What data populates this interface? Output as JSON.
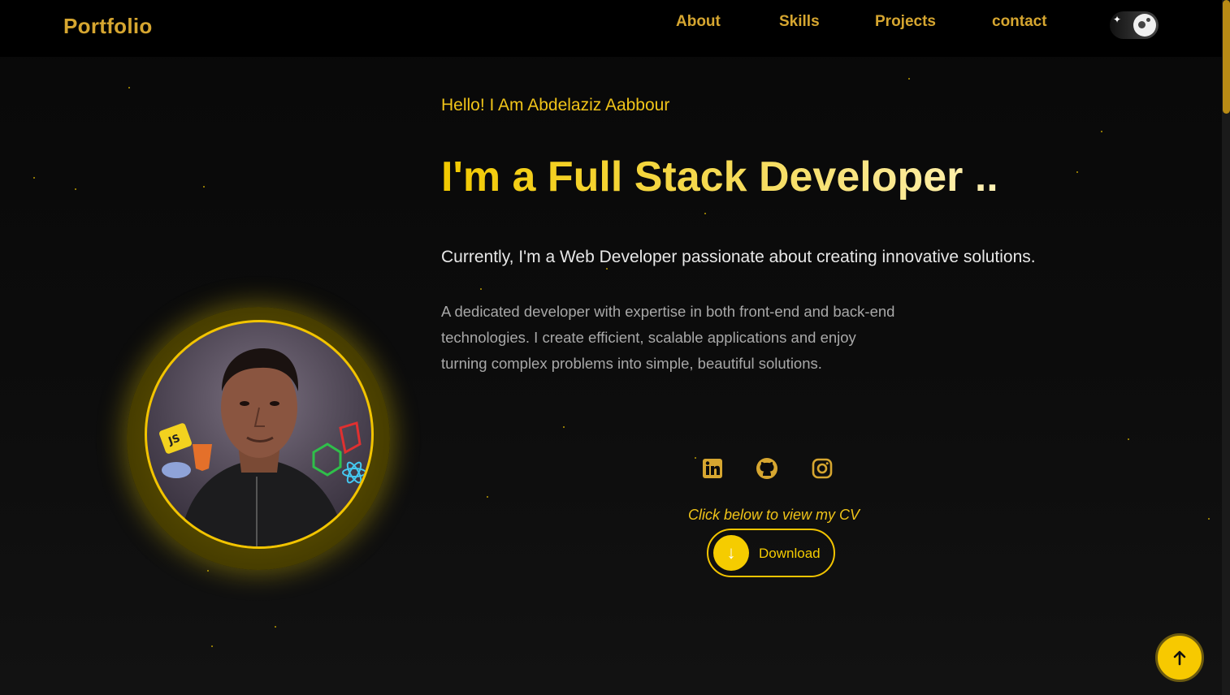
{
  "header": {
    "brand": "Portfolio",
    "nav": [
      {
        "label": "About"
      },
      {
        "label": "Skills"
      },
      {
        "label": "Projects"
      },
      {
        "label": "contact"
      }
    ],
    "theme_toggle_icon": "moon-stars-icon"
  },
  "hero": {
    "greeting": "Hello! I Am Abdelaziz Aabbour",
    "headline": "I'm a Full Stack Developer ..",
    "subtitle": "Currently, I'm a Web Developer passionate about creating innovative solutions.",
    "description": "A dedicated developer with expertise in both front-end and back-end technologies. I create efficient, scalable applications and enjoy turning complex problems into simple, beautiful solutions.",
    "social": [
      {
        "icon": "linkedin-icon"
      },
      {
        "icon": "github-icon"
      },
      {
        "icon": "instagram-icon"
      }
    ],
    "cv_hint": "Click below to view my CV",
    "download_label": "Download",
    "download_icon": "arrow-down-icon"
  },
  "back_to_top_icon": "arrow-up-icon",
  "colors": {
    "accent": "#f5cc00",
    "nav_text": "#d6a630",
    "background": "#0b0b0b"
  }
}
